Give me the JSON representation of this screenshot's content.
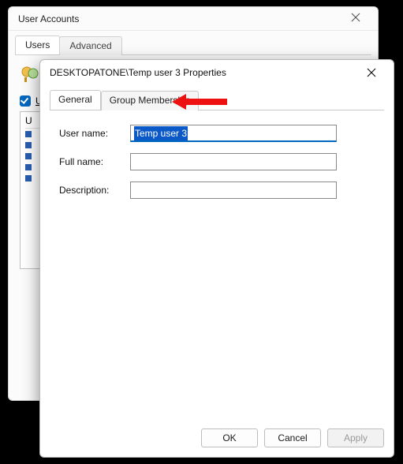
{
  "ua": {
    "title": "User Accounts",
    "tabs": [
      "Users",
      "Advanced"
    ],
    "checkbox_label_fragment": "Us",
    "list_header": "U"
  },
  "prop": {
    "title": "DESKTOPATONE\\Temp user 3 Properties",
    "tabs": {
      "general": "General",
      "group": "Group Membership"
    },
    "labels": {
      "username": "User name:",
      "fullname": "Full name:",
      "description": "Description:"
    },
    "values": {
      "username": "Temp user 3",
      "fullname": "",
      "description": ""
    },
    "buttons": {
      "ok": "OK",
      "cancel": "Cancel",
      "apply": "Apply"
    }
  }
}
